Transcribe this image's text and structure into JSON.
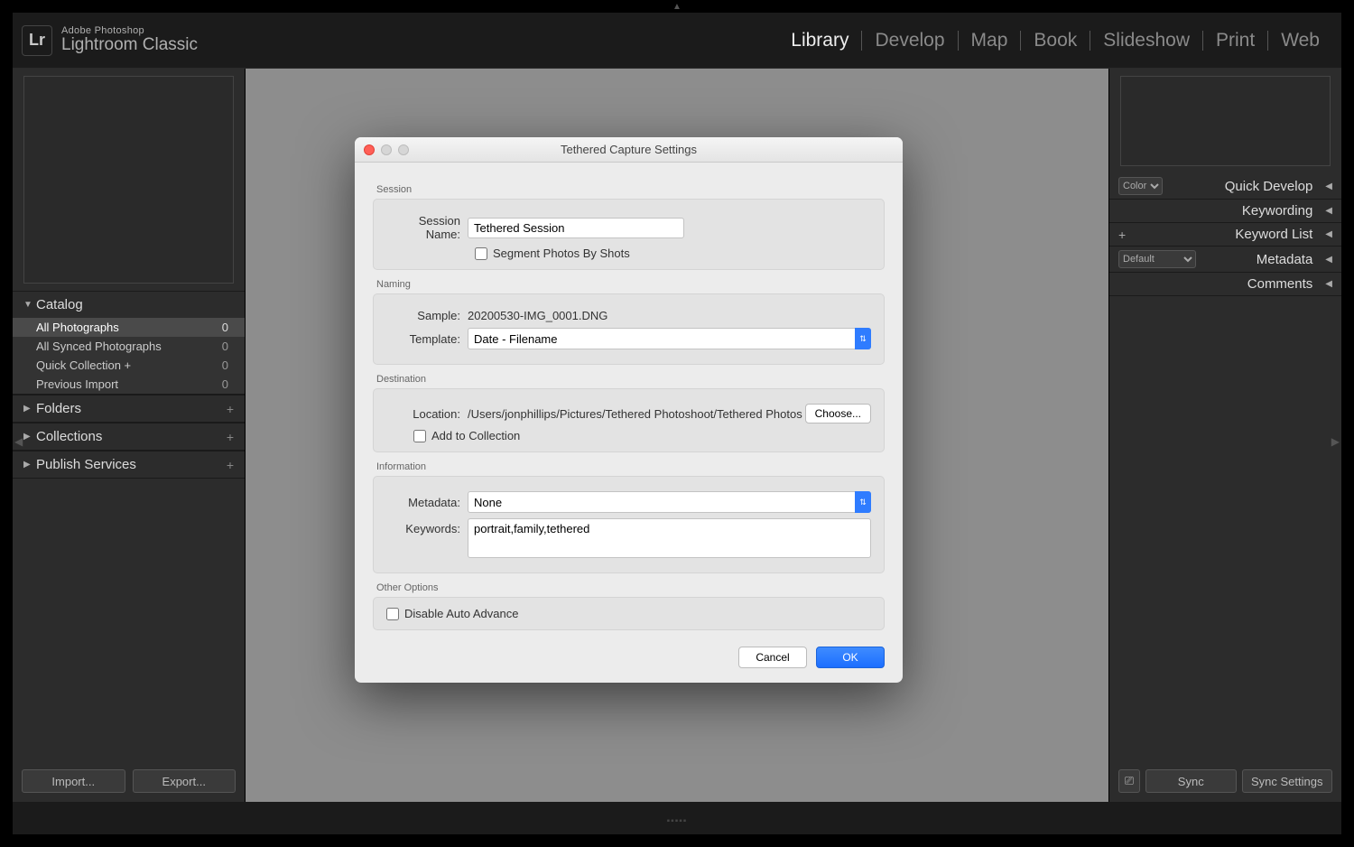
{
  "brand": {
    "logo": "Lr",
    "line1": "Adobe Photoshop",
    "line2": "Lightroom Classic"
  },
  "modules": [
    "Library",
    "Develop",
    "Map",
    "Book",
    "Slideshow",
    "Print",
    "Web"
  ],
  "active_module": "Library",
  "left": {
    "catalog_title": "Catalog",
    "items": [
      {
        "name": "All Photographs",
        "count": "0",
        "selected": true
      },
      {
        "name": "All Synced Photographs",
        "count": "0"
      },
      {
        "name": "Quick Collection  +",
        "count": "0"
      },
      {
        "name": "Previous Import",
        "count": "0"
      }
    ],
    "folders": "Folders",
    "collections": "Collections",
    "publish": "Publish Services",
    "import": "Import...",
    "export": "Export..."
  },
  "right": {
    "quickdev": "Quick Develop",
    "keywording": "Keywording",
    "keywordlist": "Keyword List",
    "metadata": "Metadata",
    "metadata_preset": "Default",
    "color_label": "Color",
    "comments": "Comments",
    "sync": "Sync",
    "syncset": "Sync Settings"
  },
  "dialog": {
    "title": "Tethered Capture Settings",
    "session": {
      "label": "Session",
      "name_label": "Session Name:",
      "name_value": "Tethered Session",
      "segment": "Segment Photos By Shots"
    },
    "naming": {
      "label": "Naming",
      "sample_label": "Sample:",
      "sample_value": "20200530-IMG_0001.DNG",
      "template_label": "Template:",
      "template_value": "Date - Filename"
    },
    "destination": {
      "label": "Destination",
      "location_label": "Location:",
      "location_value": "/Users/jonphillips/Pictures/Tethered Photoshoot/Tethered Photos",
      "choose": "Choose...",
      "add_collection": "Add to Collection"
    },
    "information": {
      "label": "Information",
      "metadata_label": "Metadata:",
      "metadata_value": "None",
      "keywords_label": "Keywords:",
      "keywords_value": "portrait,family,tethered"
    },
    "other": {
      "label": "Other Options",
      "disable": "Disable Auto Advance"
    },
    "cancel": "Cancel",
    "ok": "OK"
  }
}
